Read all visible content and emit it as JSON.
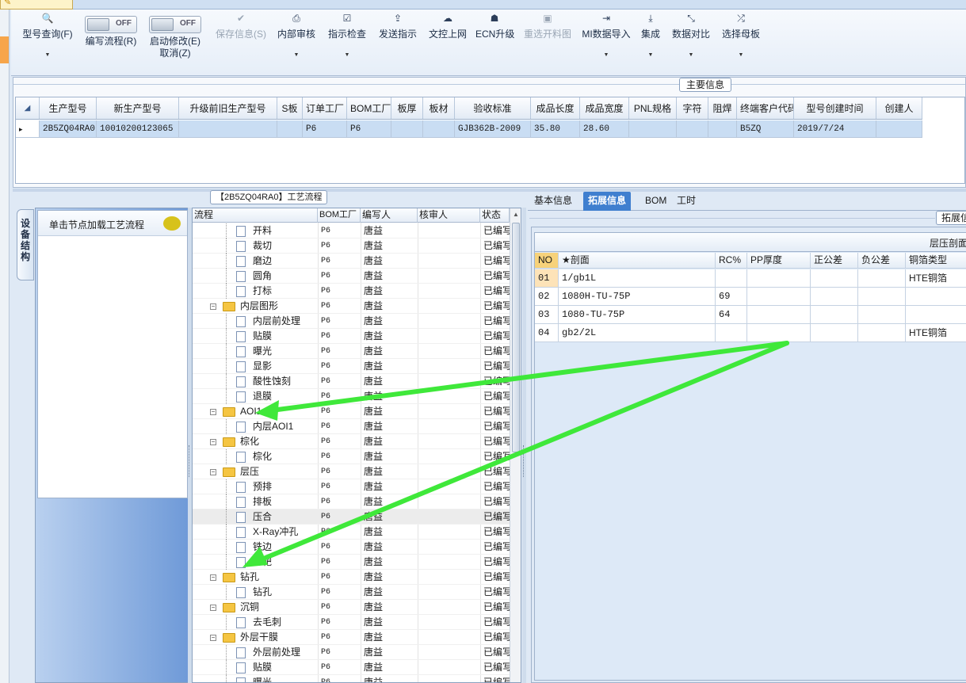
{
  "window": {
    "tab_title": ""
  },
  "ribbon": {
    "query": "型号查询(F)",
    "edit_flow": "编写流程(R)",
    "edit_flow_toggle": "OFF",
    "enable_edit": "启动修改(E)",
    "cancel": "取消(Z)",
    "enable_edit_toggle": "OFF",
    "save": "保存信息(S)",
    "internal_review": "内部审核",
    "instruction_check": "指示检查",
    "send_instruction": "发送指示",
    "upload_doc": "文控上网",
    "ecn_upgrade": "ECN升级",
    "reselect_chart": "重选开料图",
    "mi_import": "MI数据导入",
    "integrate": "集成",
    "data_compare": "数据对比",
    "select_master": "选择母板"
  },
  "main_info": {
    "legend": "主要信息",
    "columns": [
      "生产型号",
      "新生产型号",
      "升级前旧生产型号",
      "S板",
      "订单工厂",
      "BOM工厂",
      "板厚",
      "板材",
      "验收标准",
      "成品长度",
      "成品宽度",
      "PNL规格",
      "字符",
      "阻焊",
      "终端客户代码",
      "型号创建时间",
      "创建人"
    ],
    "row": [
      "2B5ZQ04RA0",
      "10010200123065",
      "",
      "",
      "P6",
      "P6",
      "",
      "",
      "GJB362B-2009",
      "35.80",
      "28.60",
      "",
      "",
      "",
      "B5ZQ",
      "2019/7/24",
      ""
    ]
  },
  "left_panel": {
    "vtab": "设备结构",
    "hint": "单击节点加载工艺流程"
  },
  "tree": {
    "legend": "【2B5ZQ04RA0】工艺流程",
    "columns": {
      "flow": "流程",
      "bom": "BOM工厂",
      "writer": "编写人",
      "reviewer": "核审人",
      "status": "状态"
    },
    "rows": [
      {
        "name": "开料",
        "level": 2,
        "bom": "P6",
        "writer": "唐益",
        "status": "已编写"
      },
      {
        "name": "裁切",
        "level": 2,
        "bom": "P6",
        "writer": "唐益",
        "status": "已编写"
      },
      {
        "name": "磨边",
        "level": 2,
        "bom": "P6",
        "writer": "唐益",
        "status": "已编写"
      },
      {
        "name": "圆角",
        "level": 2,
        "bom": "P6",
        "writer": "唐益",
        "status": "已编写"
      },
      {
        "name": "打标",
        "level": 2,
        "bom": "P6",
        "writer": "唐益",
        "status": "已编写"
      },
      {
        "name": "内层图形",
        "level": 1,
        "bom": "P6",
        "writer": "唐益",
        "status": "已编写"
      },
      {
        "name": "内层前处理",
        "level": 2,
        "bom": "P6",
        "writer": "唐益",
        "status": "已编写"
      },
      {
        "name": "贴膜",
        "level": 2,
        "bom": "P6",
        "writer": "唐益",
        "status": "已编写"
      },
      {
        "name": "曝光",
        "level": 2,
        "bom": "P6",
        "writer": "唐益",
        "status": "已编写"
      },
      {
        "name": "显影",
        "level": 2,
        "bom": "P6",
        "writer": "唐益",
        "status": "已编写"
      },
      {
        "name": "酸性蚀刻",
        "level": 2,
        "bom": "P6",
        "writer": "唐益",
        "status": "已编写"
      },
      {
        "name": "退膜",
        "level": 2,
        "bom": "P6",
        "writer": "唐益",
        "status": "已编写"
      },
      {
        "name": "AOI1",
        "level": 1,
        "bom": "P6",
        "writer": "唐益",
        "status": "已编写"
      },
      {
        "name": "内层AOI1",
        "level": 2,
        "bom": "P6",
        "writer": "唐益",
        "status": "已编写"
      },
      {
        "name": "棕化",
        "level": 1,
        "bom": "P6",
        "writer": "唐益",
        "status": "已编写"
      },
      {
        "name": "棕化",
        "level": 2,
        "bom": "P6",
        "writer": "唐益",
        "status": "已编写"
      },
      {
        "name": "层压",
        "level": 1,
        "bom": "P6",
        "writer": "唐益",
        "status": "已编写"
      },
      {
        "name": "预排",
        "level": 2,
        "bom": "P6",
        "writer": "唐益",
        "status": "已编写"
      },
      {
        "name": "排板",
        "level": 2,
        "bom": "P6",
        "writer": "唐益",
        "status": "已编写"
      },
      {
        "name": "压合",
        "level": 2,
        "bom": "P6",
        "writer": "唐益",
        "status": "已编写",
        "selected": true
      },
      {
        "name": "X-Ray冲孔",
        "level": 2,
        "bom": "P6",
        "writer": "唐益",
        "status": "已编写"
      },
      {
        "name": "铣边",
        "level": 2,
        "bom": "P6",
        "writer": "唐益",
        "status": "已编写"
      },
      {
        "name": "打靶",
        "level": 2,
        "bom": "P6",
        "writer": "唐益",
        "status": "已编写"
      },
      {
        "name": "钻孔",
        "level": 1,
        "bom": "P6",
        "writer": "唐益",
        "status": "已编写"
      },
      {
        "name": "钻孔",
        "level": 2,
        "bom": "P6",
        "writer": "唐益",
        "status": "已编写"
      },
      {
        "name": "沉铜",
        "level": 1,
        "bom": "P6",
        "writer": "唐益",
        "status": "已编写"
      },
      {
        "name": "去毛刺",
        "level": 2,
        "bom": "P6",
        "writer": "唐益",
        "status": "已编写"
      },
      {
        "name": "外层干膜",
        "level": 1,
        "bom": "P6",
        "writer": "唐益",
        "status": "已编写"
      },
      {
        "name": "外层前处理",
        "level": 2,
        "bom": "P6",
        "writer": "唐益",
        "status": "已编写"
      },
      {
        "name": "贴膜",
        "level": 2,
        "bom": "P6",
        "writer": "唐益",
        "status": "已编写"
      },
      {
        "name": "曝光",
        "level": 2,
        "bom": "P6",
        "writer": "唐益",
        "status": "已编写"
      }
    ]
  },
  "right_panel": {
    "tabs": [
      "基本信息",
      "拓展信息",
      "BOM",
      "工时"
    ],
    "active_tab": 1,
    "legend": "拓展信息",
    "caption": "层压剖面",
    "columns": [
      "NO",
      "★剖面",
      "RC%",
      "PP厚度",
      "正公差",
      "负公差",
      "铜箔类型"
    ],
    "rows": [
      [
        "01",
        "1/gb1L",
        "",
        "",
        "",
        "",
        "HTE铜箔"
      ],
      [
        "02",
        "1080H-TU-75P",
        "69",
        "",
        "",
        "",
        ""
      ],
      [
        "03",
        "1080-TU-75P",
        "64",
        "",
        "",
        "",
        ""
      ],
      [
        "04",
        "gb2/2L",
        "",
        "",
        "",
        "",
        "HTE铜箔"
      ]
    ]
  },
  "colors": {
    "annotation_arrow": "#3fe83a",
    "selected_row": "#c9ddf3",
    "active_tab": "#3f7fcf"
  }
}
